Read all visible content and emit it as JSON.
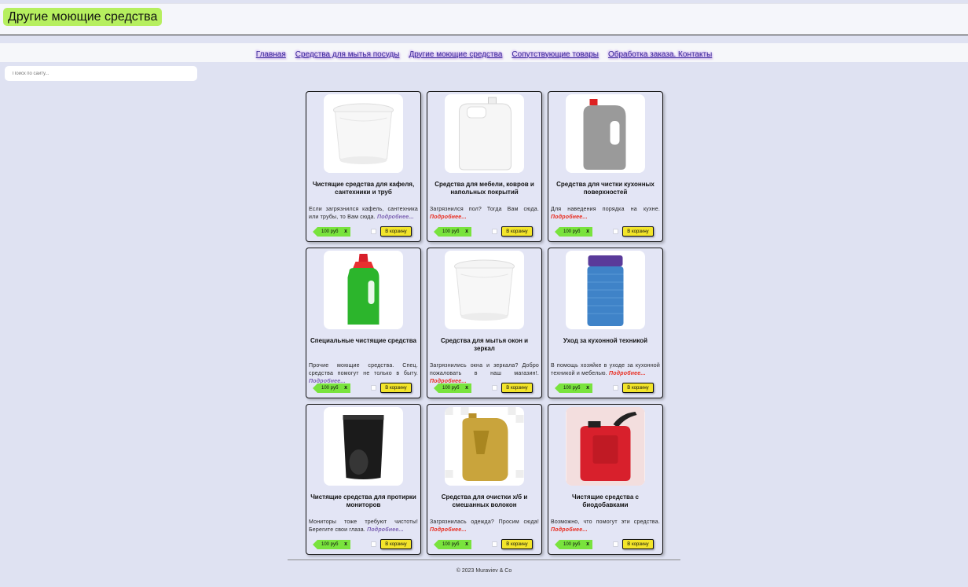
{
  "header": {
    "title": "Другие моющие средства"
  },
  "nav": {
    "items": [
      "Главная",
      "Средства для мытья посуды",
      "Другие моющие средства",
      "Сопутствующие товары",
      "Обработка заказа. Контакты"
    ]
  },
  "search": {
    "placeholder": "Поиск по сайту..."
  },
  "products": [
    {
      "title": "Чистящие средства для кафеля, сантехники и труб",
      "desc": "Если загрязнился кафель, сантехника или трубы, то Вам сюда.",
      "more": "Подробнее...",
      "more_color": "purple",
      "price": "100 руб",
      "remove": "x",
      "cart": "В корзину",
      "image": "bucket-white-image"
    },
    {
      "title": "Средства для мебели, ковров и напольных покрытий",
      "desc": "Загрязнился пол? Тогда Вам сюда.",
      "more": "Подробнее...",
      "more_color": "red",
      "price": "100 руб",
      "remove": "x",
      "cart": "В корзину",
      "image": "canister-white-image"
    },
    {
      "title": "Средства для чистки кухонных поверхностей",
      "desc": "Для наведения порядка на кухне.",
      "more": "Подробнее...",
      "more_color": "red",
      "price": "100 руб",
      "remove": "x",
      "cart": "В корзину",
      "image": "canister-grey-image"
    },
    {
      "title": "Специальные чистящие средства",
      "desc": "Прочие моющие средства. Спец. средства помогут не только в быту.",
      "more": "Подробнее...",
      "more_color": "purple",
      "price": "100 руб",
      "remove": "x",
      "cart": "В корзину",
      "image": "bottle-green-image"
    },
    {
      "title": "Средства для мытья окон и зеркал",
      "desc": "Загрязнились окна и зеркала? Добро пожаловать в наш магазин!.",
      "more": "Подробнее...",
      "more_color": "red",
      "price": "100 руб",
      "remove": "x",
      "cart": "В корзину",
      "image": "bucket-white-image"
    },
    {
      "title": "Уход за кухонной техникой",
      "desc": "В помощь хозяйке в уходе за кухонной техникой и мебелью.",
      "more": "Подробнее...",
      "more_color": "red",
      "price": "100 руб",
      "remove": "x",
      "cart": "В корзину",
      "image": "jar-blue-image"
    },
    {
      "title": "Чистящие средства для протирки мониторов",
      "desc": "Мониторы тоже требуют чистоты! Берегите свои глаза.",
      "more": "Подробнее...",
      "more_color": "purple",
      "price": "100 руб",
      "remove": "x",
      "cart": "В корзину",
      "image": "pouch-black-image"
    },
    {
      "title": "Средства для очистки х/б и смешанных волокон",
      "desc": "Загрязнилась одежда? Просим сюда!",
      "more": "Подробнее...",
      "more_color": "red",
      "price": "100 руб",
      "remove": "x",
      "cart": "В корзину",
      "image": "canister-gold-image"
    },
    {
      "title": "Чистящие средства с биодобавками",
      "desc": "Возможно, что помогут эти средства.",
      "more": "Подробнее...",
      "more_color": "red",
      "price": "100 руб",
      "remove": "x",
      "cart": "В корзину",
      "image": "jerrycan-red-image"
    }
  ],
  "footer": {
    "text": "© 2023 Muraviev & Co"
  },
  "colors": {
    "accent_green": "#79e33d",
    "title_green": "#b6ef5f",
    "cart_yellow": "#f3e52a",
    "more_red": "#e8281b",
    "more_purple": "#7a5fb2",
    "page_bg": "#dfe2f2"
  }
}
